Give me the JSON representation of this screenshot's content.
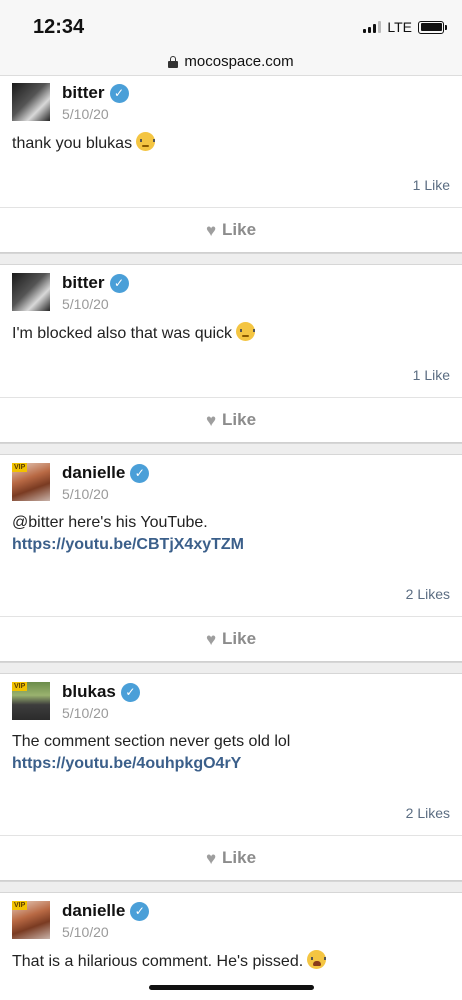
{
  "status_bar": {
    "time": "12:34",
    "network": "LTE"
  },
  "browser": {
    "url": "mocospace.com"
  },
  "posts": [
    {
      "author": "bitter",
      "date": "5/10/20",
      "text": "thank you blukas",
      "link": "",
      "likes": "1 Like",
      "like_label": "Like"
    },
    {
      "author": "bitter",
      "date": "5/10/20",
      "text": "I'm blocked also that was quick",
      "link": "",
      "likes": "1 Like",
      "like_label": "Like"
    },
    {
      "author": "danielle",
      "vip": "VIP",
      "date": "5/10/20",
      "text": "@bitter here's his YouTube.",
      "link": "https://youtu.be/CBTjX4xyTZM",
      "likes": "2 Likes",
      "like_label": "Like"
    },
    {
      "author": "blukas",
      "vip": "VIP",
      "date": "5/10/20",
      "text": "The comment section never gets old lol",
      "link": "https://youtu.be/4ouhpkgO4rY",
      "likes": "2 Likes",
      "like_label": "Like"
    },
    {
      "author": "danielle",
      "vip": "VIP",
      "date": "5/10/20",
      "text": "That is a hilarious comment. He's pissed."
    }
  ],
  "icons": {
    "verified": "verified-check-icon",
    "like": "heart-icon",
    "lock": "lock-icon"
  },
  "colors": {
    "verified": "#4a9fd8",
    "link": "#3b5f8a",
    "likes_count": "#5b6d82"
  }
}
